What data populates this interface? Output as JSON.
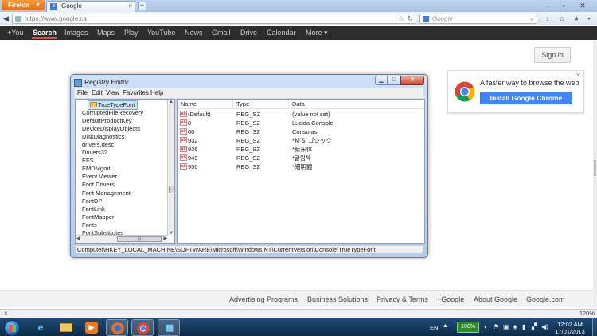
{
  "browser": {
    "menu_label": "Firefox",
    "tab_title": "Google",
    "url": "https://www.google.ca",
    "search_placeholder": "Google",
    "zoom": "120%"
  },
  "google_bar": {
    "items": [
      "+You",
      "Search",
      "Images",
      "Maps",
      "Play",
      "YouTube",
      "News",
      "Gmail",
      "Drive",
      "Calendar",
      "More ▾"
    ]
  },
  "signin_label": "Sign in",
  "promo": {
    "title": "A faster way to browse the web",
    "button": "Install Google Chrome"
  },
  "regedit": {
    "title": "Registry Editor",
    "menu": [
      "File",
      "Edit",
      "View",
      "Favorites",
      "Help"
    ],
    "tree": [
      "TrueTypeFont",
      "CorruptedFileRecovery",
      "DefaultProductKey",
      "DeviceDisplayObjects",
      "DiskDiagnostics",
      "drivers.desc",
      "Drivers32",
      "EFS",
      "EMDMgmt",
      "Event Viewer",
      "Font Drivers",
      "Font Management",
      "FontDPI",
      "FontLink",
      "FontMapper",
      "Fonts",
      "FontSubstitutes"
    ],
    "columns": [
      "Name",
      "Type",
      "Data"
    ],
    "rows": [
      [
        "(Default)",
        "REG_SZ",
        "(value not set)"
      ],
      [
        "0",
        "REG_SZ",
        "Lucida Console"
      ],
      [
        "00",
        "REG_SZ",
        "Consolas"
      ],
      [
        "932",
        "REG_SZ",
        "*ＭＳ ゴシック"
      ],
      [
        "936",
        "REG_SZ",
        "*新宋体"
      ],
      [
        "949",
        "REG_SZ",
        "*굴림체"
      ],
      [
        "950",
        "REG_SZ",
        "*細明體"
      ]
    ],
    "status_path": "Computer\\HKEY_LOCAL_MACHINE\\SOFTWARE\\Microsoft\\Windows NT\\CurrentVersion\\Console\\TrueTypeFont"
  },
  "footer": [
    "Advertising Programs",
    "Business Solutions",
    "Privacy & Terms",
    "+Google",
    "About Google",
    "Google.com"
  ],
  "taskbar": {
    "lang": "EN",
    "battery": "100%",
    "time": "12:02 AM",
    "date": "17/01/2013"
  },
  "colors": {
    "google_bar_bg": "#2d2d2d",
    "chrome_button": "#4285f4",
    "firefox_orange": "#e2701a",
    "taskbar": "#1f4b76"
  },
  "icons": {
    "promo": "chrome-logo-icon",
    "regedit_value": "string-value-icon",
    "tree_folder": "folder-icon"
  }
}
